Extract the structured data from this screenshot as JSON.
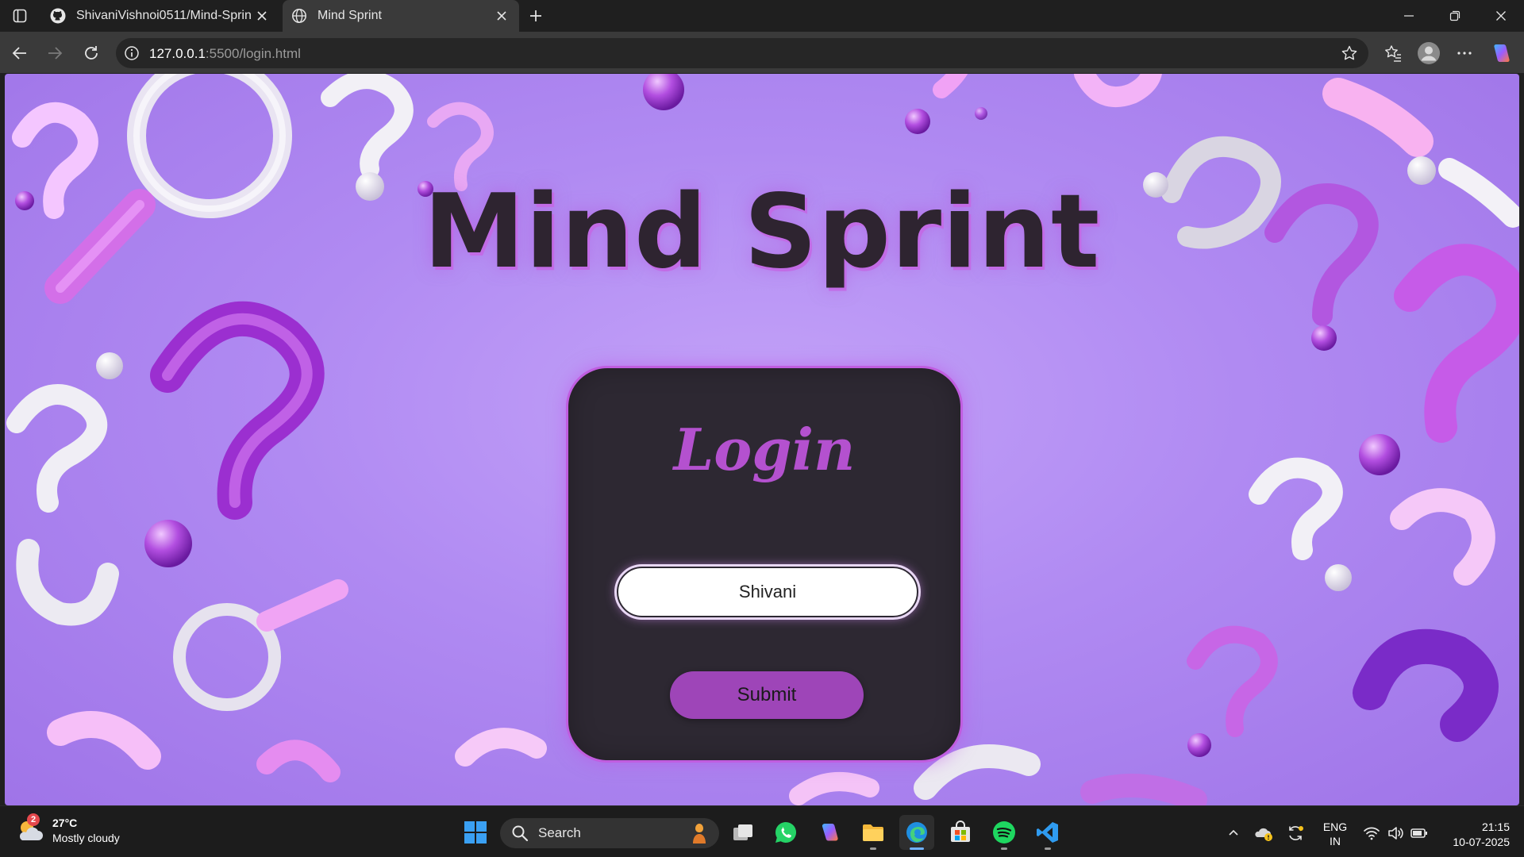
{
  "browser": {
    "tabs": [
      {
        "title": "ShivaniVishnoi0511/Mind-Sprint",
        "favicon": "github-icon",
        "active": false
      },
      {
        "title": "Mind Sprint",
        "favicon": "globe-icon",
        "active": true
      }
    ],
    "address": {
      "host": "127.0.0.1",
      "rest": ":5500/login.html"
    }
  },
  "page": {
    "title": "Mind Sprint",
    "login": {
      "heading": "Login",
      "username_value": "Shivani",
      "submit_label": "Submit"
    },
    "colors": {
      "accent": "#b451cf",
      "card": "#2d2832",
      "button": "#9e45b8",
      "background": "#b08af2"
    }
  },
  "taskbar": {
    "weather": {
      "badge": "2",
      "temperature": "27°C",
      "condition": "Mostly cloudy"
    },
    "search_label": "Search",
    "language": {
      "line1": "ENG",
      "line2": "IN"
    },
    "clock": {
      "time": "21:15",
      "date": "10-07-2025"
    }
  }
}
